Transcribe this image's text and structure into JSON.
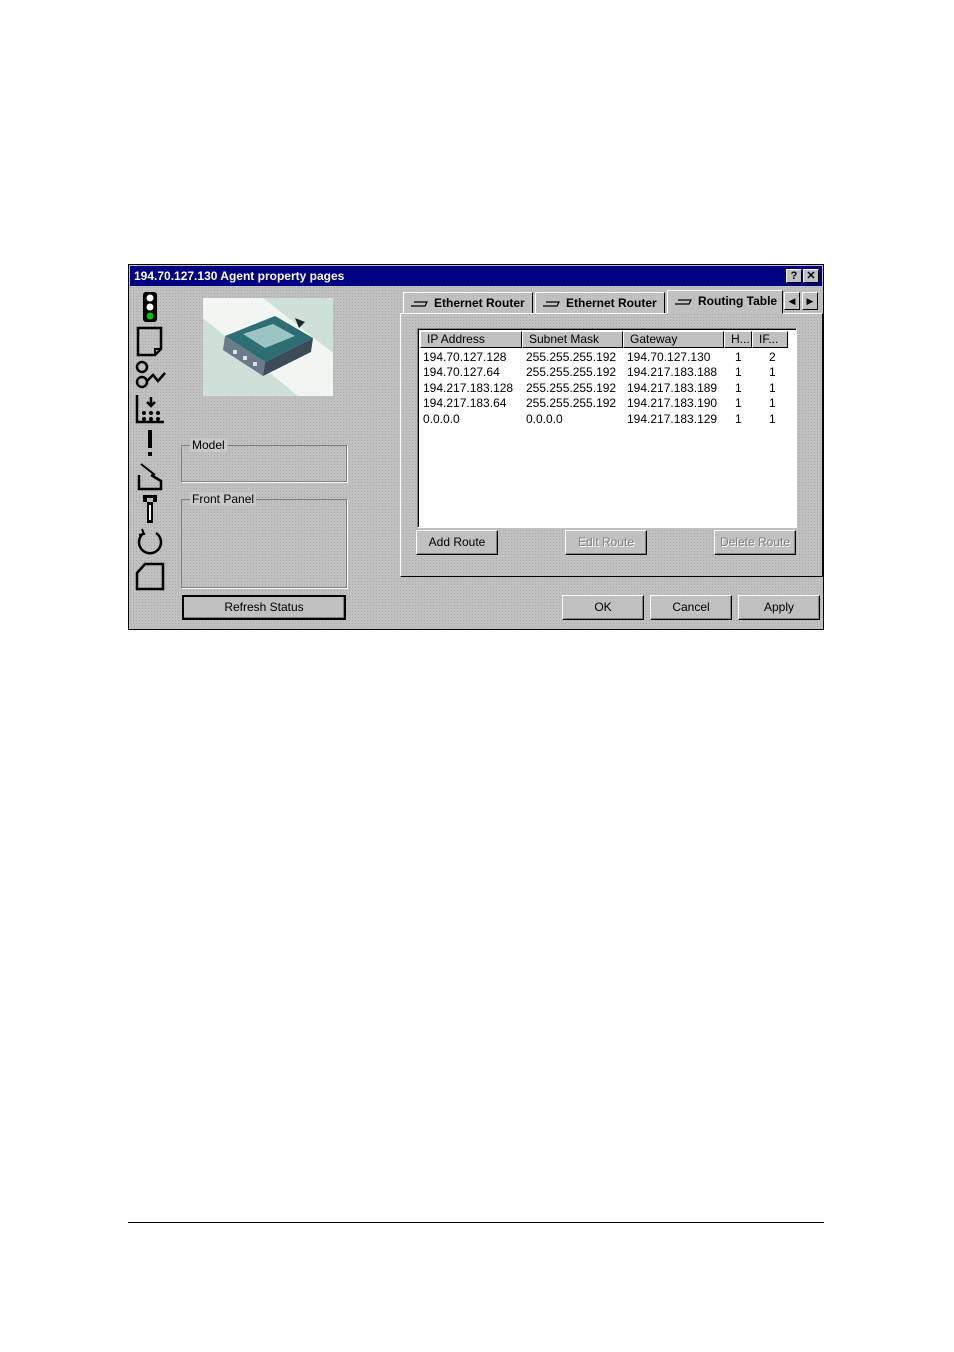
{
  "window": {
    "title": "194.70.127.130 Agent property pages",
    "help_label": "?",
    "close_label": "✕"
  },
  "nav_icons": [
    "status-light-icon",
    "page-icon",
    "network-icon",
    "statistics-icon",
    "alert-icon",
    "install-icon",
    "wrench-icon",
    "refresh-icon",
    "document-icon"
  ],
  "groups": {
    "model_label": "Model",
    "front_panel_label": "Front Panel"
  },
  "buttons": {
    "refresh_status": "Refresh Status",
    "add_route": "Add Route",
    "edit_route": "Edit Route",
    "delete_route": "Delete Route",
    "ok": "OK",
    "cancel": "Cancel",
    "apply": "Apply"
  },
  "tabs": [
    {
      "label": "Ethernet Router",
      "active": false
    },
    {
      "label": "Ethernet Router",
      "active": false
    },
    {
      "label": "Routing Table",
      "active": true
    }
  ],
  "tab_scroll": {
    "left": "◀",
    "right": "▶"
  },
  "routing_table": {
    "columns": [
      "IP Address",
      "Subnet Mask",
      "Gateway",
      "H...",
      "IF..."
    ],
    "rows": [
      [
        "194.70.127.128",
        "255.255.255.192",
        "194.70.127.130",
        "1",
        "2"
      ],
      [
        "194.70.127.64",
        "255.255.255.192",
        "194.217.183.188",
        "1",
        "1"
      ],
      [
        "194.217.183.128",
        "255.255.255.192",
        "194.217.183.189",
        "1",
        "1"
      ],
      [
        "194.217.183.64",
        "255.255.255.192",
        "194.217.183.190",
        "1",
        "1"
      ],
      [
        "0.0.0.0",
        "0.0.0.0",
        "194.217.183.129",
        "1",
        "1"
      ]
    ]
  },
  "colors": {
    "titlebar": "#000080",
    "face": "#c0c0c0",
    "status_green": "#00c000"
  }
}
